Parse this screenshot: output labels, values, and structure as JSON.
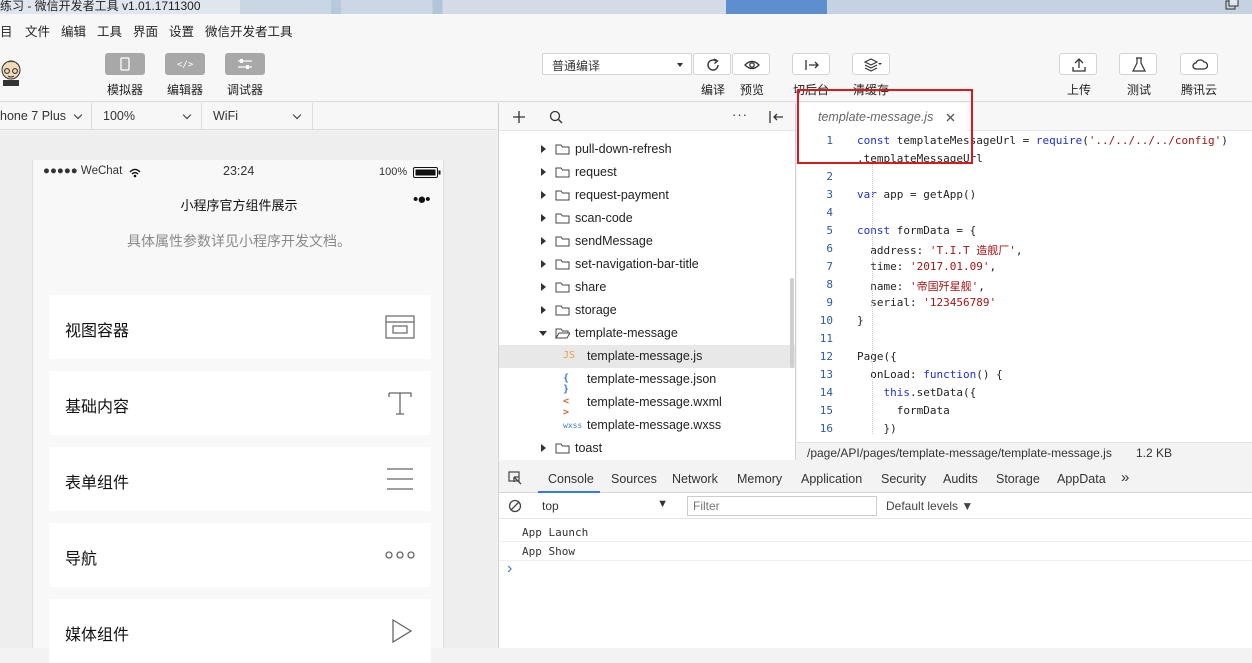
{
  "window": {
    "title": "练习 - 微信开发者工具 v1.01.1711300"
  },
  "menu": [
    "目",
    "文件",
    "编辑",
    "工具",
    "界面",
    "设置",
    "微信开发者工具"
  ],
  "toolbar": {
    "left_buttons": [
      "模拟器",
      "编辑器",
      "调试器"
    ],
    "compile_mode": "普通编译",
    "mid_buttons": [
      "编译",
      "预览",
      "切后台",
      "清缓存"
    ],
    "right_buttons": [
      "上传",
      "测试",
      "腾讯云"
    ]
  },
  "device_bar": {
    "device": "hone 7 Plus",
    "zoom": "100%",
    "network": "WiFi"
  },
  "simulator": {
    "carrier": "●●●●● WeChat",
    "time": "23:24",
    "battery": "100%",
    "nav_title": "小程序官方组件展示",
    "menu_dots": "•●•",
    "subtitle": "具体属性参数详见小程序开发文档。",
    "cards": [
      {
        "label": "视图容器",
        "icon": "view-container-icon"
      },
      {
        "label": "基础内容",
        "icon": "text-t-icon"
      },
      {
        "label": "表单组件",
        "icon": "form-lines-icon"
      },
      {
        "label": "导航",
        "icon": "more-dots-icon"
      },
      {
        "label": "媒体组件",
        "icon": "play-icon"
      }
    ]
  },
  "file_tree": {
    "folders_top": [
      "pull-down-refresh",
      "request",
      "request-payment",
      "scan-code",
      "sendMessage",
      "set-navigation-bar-title",
      "share",
      "storage"
    ],
    "open_folder": "template-message",
    "files": [
      {
        "icon": "JS",
        "name": "template-message.js",
        "color": "#e8a33d"
      },
      {
        "icon": "{ }",
        "name": "template-message.json",
        "color": "#3b7bd8"
      },
      {
        "icon": "< >",
        "name": "template-message.wxml",
        "color": "#e0612e"
      },
      {
        "icon": "wxss",
        "name": "template-message.wxss",
        "color": "#3b7bd8"
      }
    ],
    "folder_bottom": "toast"
  },
  "editor": {
    "tab": "template-message.js",
    "line_numbers": [
      "1",
      "",
      "2",
      "3",
      "4",
      "5",
      "6",
      "7",
      "8",
      "9",
      "10",
      "11",
      "12",
      "13",
      "14",
      "15",
      "16"
    ],
    "path": "/page/API/pages/template-message/template-message.js",
    "size": "1.2 KB"
  },
  "devtools": {
    "tabs": [
      "Console",
      "Sources",
      "Network",
      "Memory",
      "Application",
      "Security",
      "Audits",
      "Storage",
      "AppData",
      "»"
    ],
    "context": "top",
    "filter_placeholder": "Filter",
    "levels": "Default levels ▼",
    "logs": [
      "App Launch",
      "App Show"
    ],
    "prompt": "›"
  },
  "colors": {
    "highlight_box": "#d9191c",
    "active_tab": "#3a7bd5"
  }
}
